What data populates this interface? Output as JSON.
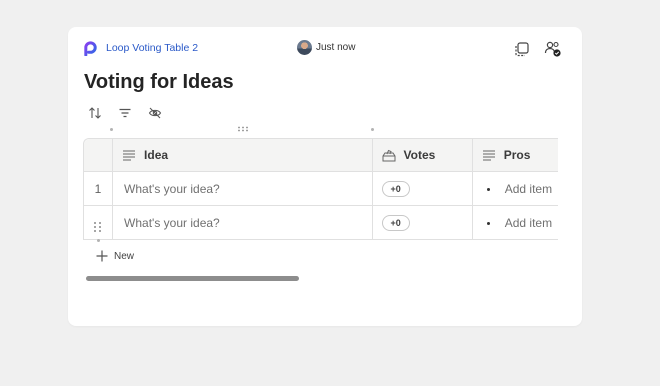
{
  "header": {
    "app_name": "Loop Voting Table 2",
    "presence_text": "Just now",
    "icons": [
      "loop-logo-icon",
      "copy-component-icon",
      "share-people-icon"
    ]
  },
  "title": "Voting for Ideas",
  "toolbar": {
    "buttons": [
      "sort-icon",
      "filter-icon",
      "hide-columns-icon"
    ]
  },
  "table": {
    "columns": [
      {
        "label": "Idea",
        "icon": "text-lines-icon"
      },
      {
        "label": "Votes",
        "icon": "ballot-box-icon"
      },
      {
        "label": "Pros",
        "icon": "text-lines-icon"
      }
    ],
    "rows": [
      {
        "index": "1",
        "idea": "What's your idea?",
        "votes": "+0",
        "pros": "Add item"
      },
      {
        "index": "",
        "idea": "What's your idea?",
        "votes": "+0",
        "pros": "Add item"
      }
    ]
  },
  "new_row_label": "New",
  "horizontal_scroll": {
    "visible_fraction": 0.66
  },
  "colors": {
    "accent": "#2a59c8",
    "loop_purple": "#6b3fd1"
  }
}
